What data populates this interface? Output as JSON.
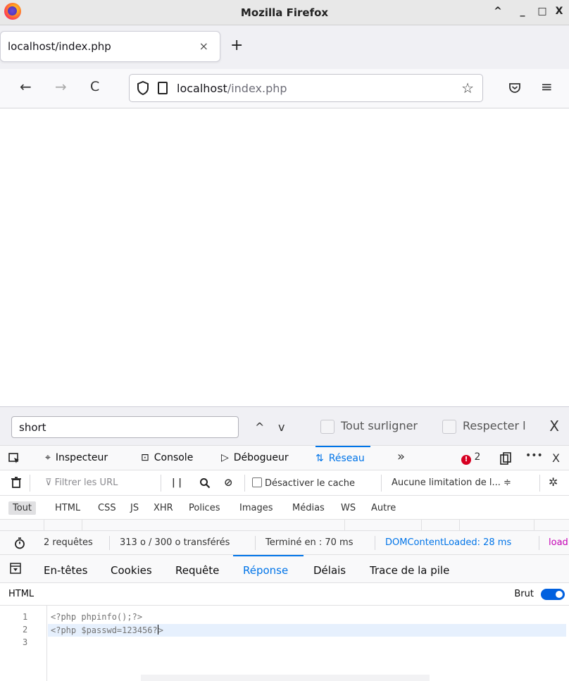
{
  "window": {
    "title": "Mozilla Firefox",
    "controls": {
      "up": "^",
      "minimize": "_",
      "maximize": "□",
      "close": "X"
    }
  },
  "tab": {
    "title": "localhost/index.php",
    "close": "×",
    "new_tab": "+"
  },
  "nav": {
    "back": "←",
    "forward": "→",
    "reload": "C",
    "url_host": "localhost",
    "url_path": "/index.php",
    "bookmark": "☆",
    "menu": "≡"
  },
  "findbar": {
    "query": "short",
    "prev": "^",
    "next": "v",
    "highlight_all": "Tout surligner",
    "match_case": "Respecter l",
    "close": "X"
  },
  "devtools": {
    "tabs": [
      {
        "icon": "⌖",
        "label": "Inspecteur"
      },
      {
        "icon": "⊡",
        "label": "Console"
      },
      {
        "icon": "▷",
        "label": "Débogueur"
      },
      {
        "icon": "⇅",
        "label": "Réseau"
      }
    ],
    "more": "»",
    "errors": "2",
    "error_mark": "!",
    "dots": "•••",
    "close": "X",
    "filter_placeholder": "Filtrer les URL",
    "pause": "| |",
    "search": "🔍",
    "block": "⊘",
    "disable_cache": "Désactiver le cache",
    "throttling": "Aucune limitation de l... ≑",
    "gear": "✲",
    "types": [
      "Tout",
      "HTML",
      "CSS",
      "JS",
      "XHR",
      "Polices",
      "Images",
      "Médias",
      "WS",
      "Autre"
    ],
    "status": {
      "requests": "2 requêtes",
      "transferred": "313 o / 300 o transférés",
      "finished": "Terminé en : 70 ms",
      "dom": "DOMContentLoaded: 28 ms",
      "load": "load"
    },
    "details_tabs": [
      "En-têtes",
      "Cookies",
      "Requête",
      "Réponse",
      "Délais",
      "Trace de la pile"
    ],
    "response_type": "HTML",
    "raw_label": "Brut",
    "code_lines": [
      {
        "n": "1",
        "text": "<?php phpinfo();?>"
      },
      {
        "n": "2",
        "text": "<?php $passwd=123456?",
        "after": ">"
      },
      {
        "n": "3",
        "text": ""
      }
    ]
  },
  "colors": {
    "accent": "#0074e8",
    "toggle": "#0060df",
    "error": "#d70022",
    "highlight_line": "#e6f0fd"
  }
}
